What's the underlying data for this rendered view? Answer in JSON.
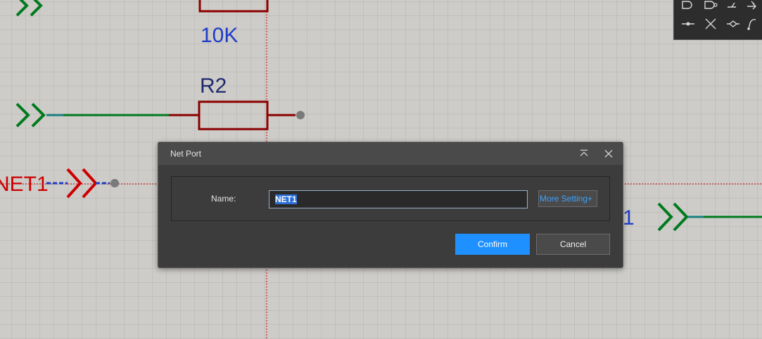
{
  "schematic": {
    "resistor_value_label": "10K",
    "resistor_designator": "R2",
    "net_label_left": "NET1",
    "net_label_right_partial": "1",
    "colors": {
      "wire": "#007a1e",
      "component": "#8b0000",
      "netport_selected": "#cc0000",
      "label_blue": "#1e3cc8",
      "crosshair": "#cc0000",
      "pin_dot": "#7a7a7a"
    }
  },
  "tool_palette": {
    "icons": [
      "gate-shape-icon",
      "gate-shape-icon",
      "junction-icon",
      "arrow-icon",
      "wire-junction-icon",
      "no-connect-icon",
      "bus-entry-icon",
      "wire-draw-icon"
    ]
  },
  "dialog": {
    "title": "Net Port",
    "name_label": "Name:",
    "name_value": "NET1",
    "more_setting_label": "More Setting+",
    "confirm_label": "Confirm",
    "cancel_label": "Cancel",
    "colors": {
      "confirm_bg": "#1e90ff",
      "link": "#3ea2ff"
    }
  }
}
